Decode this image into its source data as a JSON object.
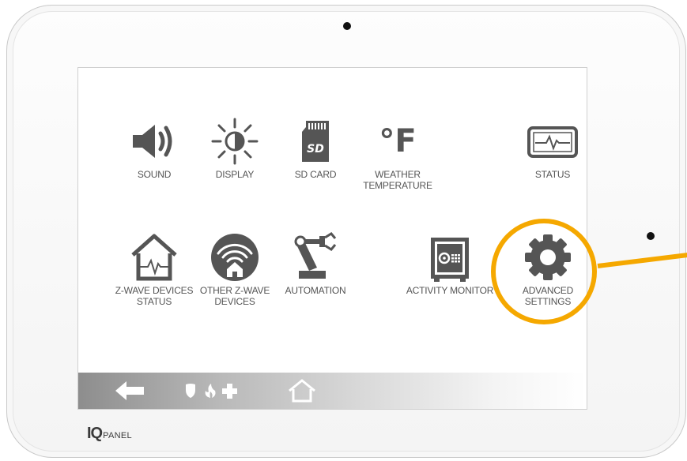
{
  "brand": {
    "iq": "IQ",
    "panel": "PANEL"
  },
  "tiles": [
    {
      "label": "SOUND",
      "icon": "speaker-icon"
    },
    {
      "label": "DISPLAY",
      "icon": "brightness-icon"
    },
    {
      "label": "SD CARD",
      "icon": "sd-card-icon"
    },
    {
      "label": "WEATHER\nTEMPERATURE",
      "icon": "fahrenheit-icon"
    },
    {
      "label": "STATUS",
      "icon": "tablet-pulse-icon"
    },
    {
      "label": "Z-WAVE DEVICES\nSTATUS",
      "icon": "house-pulse-icon"
    },
    {
      "label": "OTHER Z-WAVE\nDEVICES",
      "icon": "house-wifi-icon"
    },
    {
      "label": "AUTOMATION",
      "icon": "robot-arm-icon"
    },
    {
      "label": "ACTIVITY MONITOR",
      "icon": "safe-icon"
    },
    {
      "label": "ADVANCED\nSETTINGS",
      "icon": "gear-icon"
    }
  ],
  "icons": {
    "weather_glyph": "°F"
  },
  "navbar": {
    "back": "back-arrow-icon",
    "emergency": "emergency-icons",
    "home": "home-icon"
  },
  "colors": {
    "highlight": "#f5a800",
    "icon": "#555555"
  }
}
